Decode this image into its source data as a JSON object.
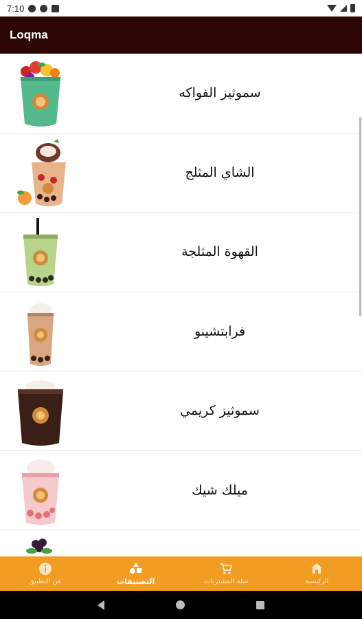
{
  "status_bar": {
    "time": "7:10"
  },
  "app_bar": {
    "title": "Loqma"
  },
  "categories": [
    {
      "label": "سموثيز الفواكه",
      "icon": "fruit-smoothie-icon"
    },
    {
      "label": "الشاي المثلج",
      "icon": "iced-tea-icon"
    },
    {
      "label": "القهوة المثلجة",
      "icon": "iced-coffee-icon"
    },
    {
      "label": "فرابتشينو",
      "icon": "frappuccino-icon"
    },
    {
      "label": "سموثيز كريمي",
      "icon": "creamy-smoothie-icon"
    },
    {
      "label": "ميلك شيك",
      "icon": "milkshake-icon"
    },
    {
      "label": "",
      "icon": "berries-icon"
    }
  ],
  "bottom_nav": [
    {
      "label": "عن التطبيق",
      "icon": "info-icon",
      "active": false
    },
    {
      "label": "التصنيفات",
      "icon": "categories-icon",
      "active": true
    },
    {
      "label": "سلة المشتريات",
      "icon": "cart-icon",
      "active": false
    },
    {
      "label": "الرئيسية",
      "icon": "home-icon",
      "active": false
    }
  ],
  "colors": {
    "app_bar": "#2c0704",
    "bottom_nav": "#f19c22",
    "accent_active": "#ffffff"
  }
}
